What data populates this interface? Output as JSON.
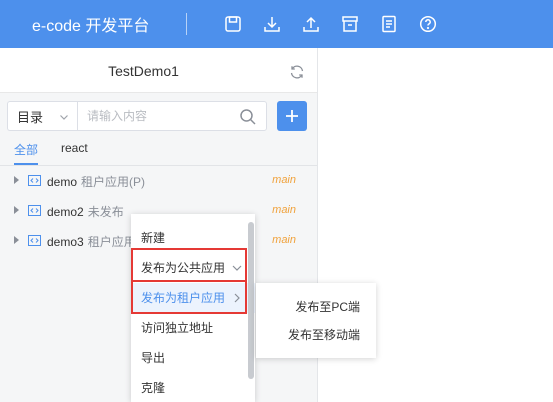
{
  "header": {
    "brand": "e-code 开发平台",
    "tools": [
      "save-icon",
      "download-icon",
      "upload-icon",
      "store-icon",
      "document-icon",
      "help-icon"
    ],
    "colors": {
      "bar": "#4d90ec"
    }
  },
  "project": {
    "title": "TestDemo1"
  },
  "search": {
    "select_value": "目录",
    "placeholder": "请输入内容"
  },
  "tabs": [
    {
      "label": "全部",
      "active": true
    },
    {
      "label": "react",
      "active": false
    }
  ],
  "apps": [
    {
      "name": "demo",
      "sub": "租户应用(P)",
      "branch": "main"
    },
    {
      "name": "demo2",
      "sub": "未发布",
      "branch": "main"
    },
    {
      "name": "demo3",
      "sub": "租户应用",
      "branch": "main"
    }
  ],
  "context_menu": {
    "items": [
      {
        "label": "新建"
      },
      {
        "label": "发布为公共应用"
      },
      {
        "label": "发布为租户应用"
      },
      {
        "label": "访问独立地址"
      },
      {
        "label": "导出"
      },
      {
        "label": "克隆"
      }
    ]
  },
  "submenu": {
    "items": [
      {
        "label": "发布至PC端"
      },
      {
        "label": "发布至移动端"
      }
    ]
  }
}
